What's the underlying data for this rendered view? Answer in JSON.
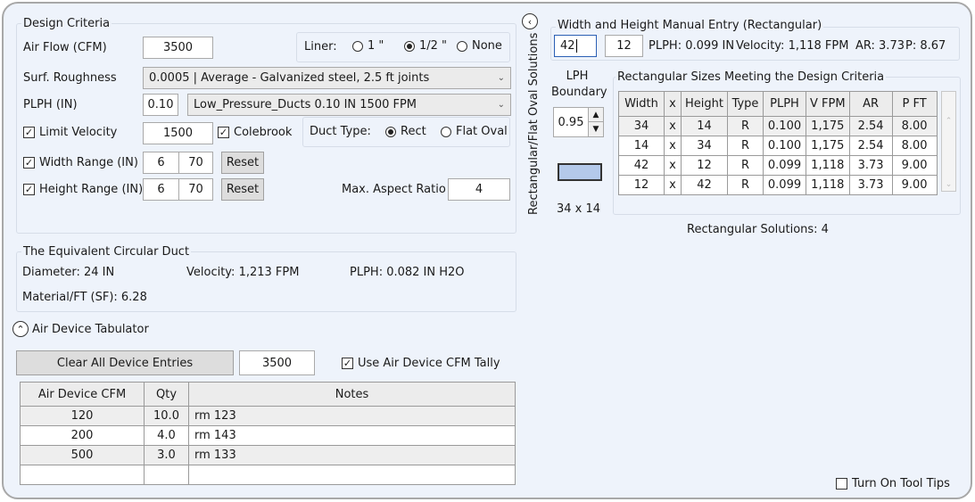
{
  "design_criteria": {
    "title": "Design Criteria",
    "air_flow_label": "Air Flow (CFM)",
    "air_flow_value": "3500",
    "liner_label": "Liner:",
    "liner_options": [
      "1 \"",
      "1/2 \"",
      "None"
    ],
    "liner_selected": "1/2 \"",
    "surf_roughness_label": "Surf. Roughness",
    "surf_roughness_value": "0.0005 | Average - Galvanized steel, 2.5 ft joints",
    "plph_label": "PLPH (IN)",
    "plph_value": "0.10",
    "plph_preset": "Low_Pressure_Ducts  0.10 IN  1500 FPM",
    "limit_velocity_label": "Limit Velocity",
    "limit_velocity_value": "1500",
    "colebrook_label": "Colebrook",
    "duct_type_label": "Duct Type:",
    "duct_type_options": [
      "Rect",
      "Flat Oval"
    ],
    "duct_type_selected": "Rect",
    "width_range_label": "Width Range (IN)",
    "width_min": "6",
    "width_max": "70",
    "height_range_label": "Height Range (IN)",
    "height_min": "6",
    "height_max": "70",
    "reset_label": "Reset",
    "max_aspect_label": "Max. Aspect Ratio",
    "max_aspect_value": "4"
  },
  "equivalent": {
    "title": "The Equivalent Circular Duct",
    "diameter": "Diameter: 24 IN",
    "velocity": "Velocity: 1,213 FPM",
    "plph": "PLPH: 0.082 IN H2O",
    "material": "Material/FT (SF): 6.28"
  },
  "tabulator": {
    "toggle_label": "Air Device Tabulator",
    "clear_label": "Clear All Device Entries",
    "total_value": "3500",
    "use_tally_label": "Use Air Device CFM Tally",
    "columns": [
      "Air Device CFM",
      "Qty",
      "Notes"
    ],
    "rows": [
      [
        "120",
        "10.0",
        "rm 123"
      ],
      [
        "200",
        "4.0",
        "rm 143"
      ],
      [
        "500",
        "3.0",
        "rm 133"
      ],
      [
        "",
        "",
        ""
      ]
    ]
  },
  "side": {
    "vertical_label": "Rectangular/Flat Oval Solutions",
    "lph_title_line1": "LPH",
    "lph_title_line2": "Boundary",
    "lph_value": "0.95",
    "size_label": "34 x 14",
    "swatch_color": "#b4c9ea"
  },
  "manual": {
    "title": "Width and Height Manual Entry (Rectangular)",
    "width_value": "42",
    "height_value": "12",
    "plph": "PLPH: 0.099 IN",
    "velocity": "Velocity: 1,118 FPM",
    "ar": "AR: 3.73",
    "p": "P: 8.67"
  },
  "sizes": {
    "title": "Rectangular Sizes Meeting the Design Criteria",
    "columns": [
      "Width",
      "x",
      "Height",
      "Type",
      "PLPH",
      "V FPM",
      "AR",
      "P FT"
    ],
    "rows": [
      [
        "34",
        "x",
        "14",
        "R",
        "0.100",
        "1,175",
        "2.54",
        "8.00"
      ],
      [
        "14",
        "x",
        "34",
        "R",
        "0.100",
        "1,175",
        "2.54",
        "8.00"
      ],
      [
        "42",
        "x",
        "12",
        "R",
        "0.099",
        "1,118",
        "3.73",
        "9.00"
      ],
      [
        "12",
        "x",
        "42",
        "R",
        "0.099",
        "1,118",
        "3.73",
        "9.00"
      ]
    ],
    "solutions_count": "Rectangular Solutions: 4"
  },
  "tooltips_label": "Turn On Tool Tips",
  "icons": {
    "collapse": "chevron-left-circle-icon",
    "expand": "chevron-up-circle-icon"
  }
}
